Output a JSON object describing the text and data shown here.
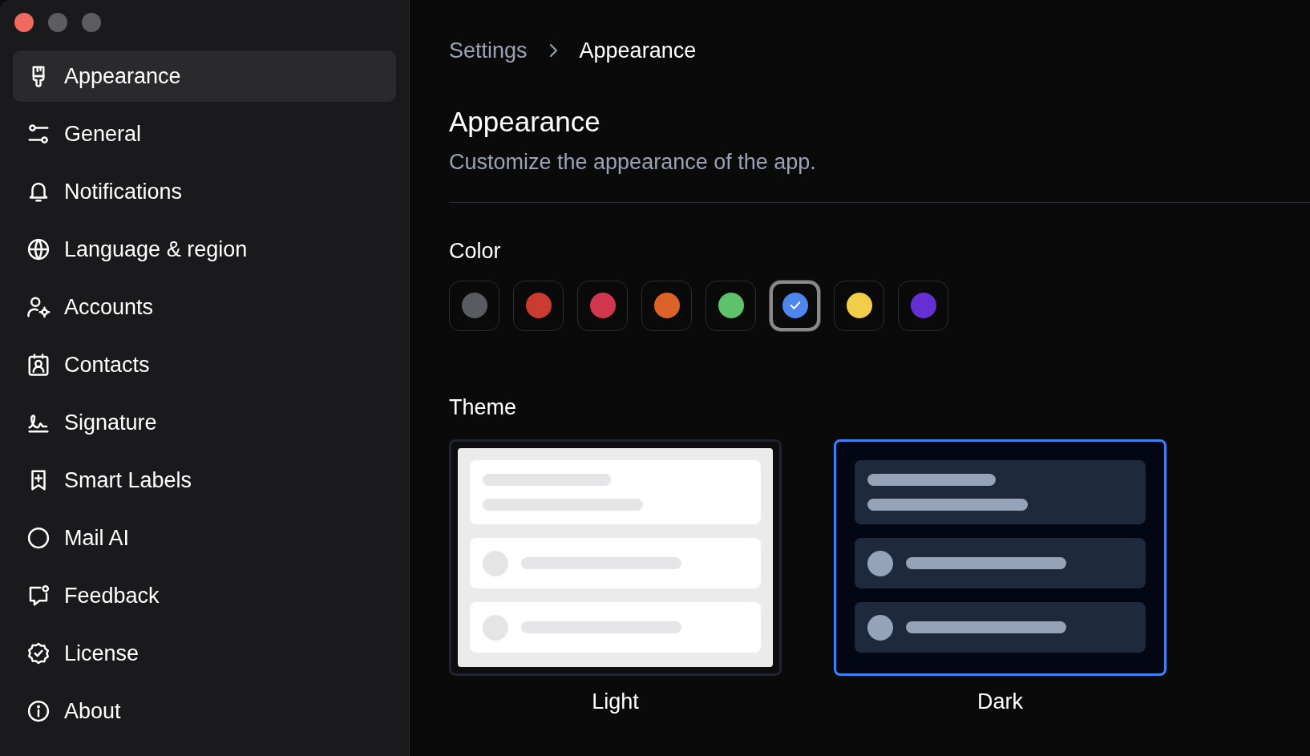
{
  "window": {
    "controls": [
      {
        "kind": "close"
      },
      {
        "kind": "minimize"
      },
      {
        "kind": "zoom"
      }
    ]
  },
  "sidebar": {
    "items": [
      {
        "label": "Appearance",
        "selected": true
      },
      {
        "label": "General",
        "selected": false
      },
      {
        "label": "Notifications",
        "selected": false
      },
      {
        "label": "Language & region",
        "selected": false
      },
      {
        "label": "Accounts",
        "selected": false
      },
      {
        "label": "Contacts",
        "selected": false
      },
      {
        "label": "Signature",
        "selected": false
      },
      {
        "label": "Smart Labels",
        "selected": false
      },
      {
        "label": "Mail AI",
        "selected": false
      },
      {
        "label": "Feedback",
        "selected": false
      },
      {
        "label": "License",
        "selected": false
      },
      {
        "label": "About",
        "selected": false
      }
    ]
  },
  "breadcrumb": [
    "Settings",
    "Appearance"
  ],
  "title": "Appearance",
  "subtitle": "Customize the appearance of the app.",
  "color": {
    "label": "Color",
    "swatches": [
      {
        "color": "#5a5a62",
        "selected": false
      },
      {
        "color": "#ca3b30",
        "selected": false
      },
      {
        "color": "#d0374c",
        "selected": false
      },
      {
        "color": "#db6229",
        "selected": false
      },
      {
        "color": "#5ec26b",
        "selected": false
      },
      {
        "color": "#4f86ee",
        "selected": true
      },
      {
        "color": "#f2cd4a",
        "selected": false
      },
      {
        "color": "#662fd3",
        "selected": false
      }
    ]
  },
  "theme": {
    "label": "Theme",
    "options": [
      {
        "label": "Light",
        "kind": "light",
        "selected": false
      },
      {
        "label": "Dark",
        "kind": "dark",
        "selected": true
      }
    ]
  }
}
